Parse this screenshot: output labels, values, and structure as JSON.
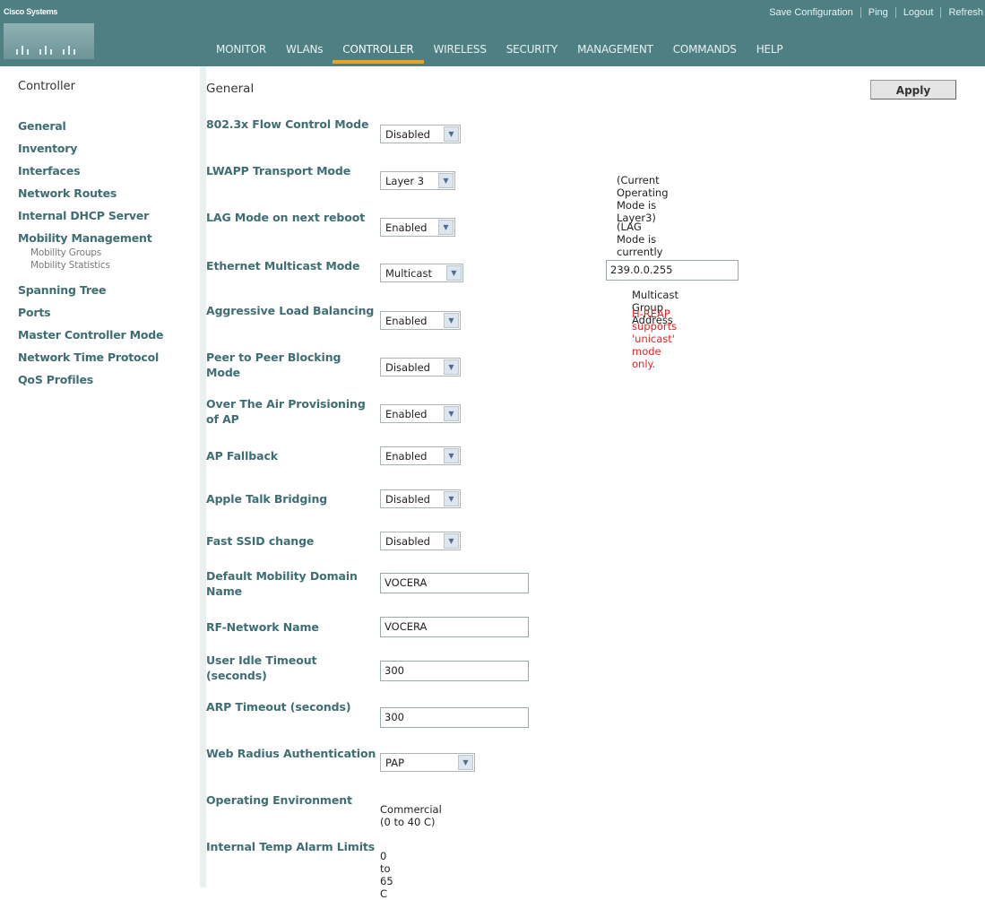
{
  "header": {
    "brand": "Cisco Systems",
    "util_links": [
      "Save Configuration",
      "Ping",
      "Logout",
      "Refresh"
    ],
    "nav": [
      {
        "label": "MONITOR"
      },
      {
        "label": "WLANs"
      },
      {
        "label": "CONTROLLER",
        "active": true
      },
      {
        "label": "WIRELESS"
      },
      {
        "label": "SECURITY"
      },
      {
        "label": "MANAGEMENT"
      },
      {
        "label": "COMMANDS"
      },
      {
        "label": "HELP"
      }
    ]
  },
  "sidebar": {
    "title": "Controller",
    "items": [
      {
        "label": "General"
      },
      {
        "label": "Inventory"
      },
      {
        "label": "Interfaces"
      },
      {
        "label": "Network Routes"
      },
      {
        "label": "Internal DHCP Server"
      },
      {
        "label": "Mobility Management",
        "sub": [
          "Mobility Groups",
          "Mobility Statistics"
        ]
      },
      {
        "label": "Spanning Tree"
      },
      {
        "label": "Ports"
      },
      {
        "label": "Master Controller Mode"
      },
      {
        "label": "Network Time Protocol"
      },
      {
        "label": "QoS Profiles"
      }
    ]
  },
  "main": {
    "title": "General",
    "apply_label": "Apply",
    "fields": {
      "flow_control": {
        "label": "802.3x Flow Control Mode",
        "value": "Disabled"
      },
      "lwapp_transport": {
        "label": "LWAPP Transport Mode",
        "value": "Layer 3",
        "note": "(Current Operating Mode is Layer3)"
      },
      "lag_mode": {
        "label": "LAG Mode on next reboot",
        "value": "Enabled",
        "note": "(LAG Mode is currently enabled)."
      },
      "eth_multicast": {
        "label": "Ethernet Multicast Mode",
        "value": "Multicast",
        "address": "239.0.0.255",
        "address_label": "Multicast Group Address",
        "warning": "H-REAP supports 'unicast' mode only."
      },
      "aggressive_lb": {
        "label": "Aggressive Load Balancing",
        "value": "Enabled"
      },
      "p2p_blocking": {
        "label": "Peer to Peer Blocking Mode",
        "value": "Disabled"
      },
      "ota_provisioning": {
        "label": "Over The Air Provisioning of AP",
        "value": "Enabled"
      },
      "ap_fallback": {
        "label": "AP Fallback",
        "value": "Enabled"
      },
      "apple_talk": {
        "label": "Apple Talk Bridging",
        "value": "Disabled"
      },
      "fast_ssid": {
        "label": "Fast SSID change",
        "value": "Disabled"
      },
      "mobility_domain": {
        "label": "Default Mobility Domain Name",
        "value": "VOCERA"
      },
      "rf_network": {
        "label": "RF-Network Name",
        "value": "VOCERA"
      },
      "user_idle": {
        "label": "User Idle Timeout (seconds)",
        "value": "300"
      },
      "arp_timeout": {
        "label": "ARP Timeout (seconds)",
        "value": "300"
      },
      "web_radius": {
        "label": "Web Radius Authentication",
        "value": "PAP"
      },
      "operating_env": {
        "label": "Operating Environment",
        "value": "Commercial (0 to 40 C)"
      },
      "temp_alarm": {
        "label": "Internal Temp Alarm Limits",
        "value": "0 to 65 C"
      }
    }
  },
  "colors": {
    "header_bg": "#4d7f83",
    "active_tab_underline": "#f3a11b",
    "label_teal": "#3d6e73",
    "warning_red": "#ee2222"
  }
}
